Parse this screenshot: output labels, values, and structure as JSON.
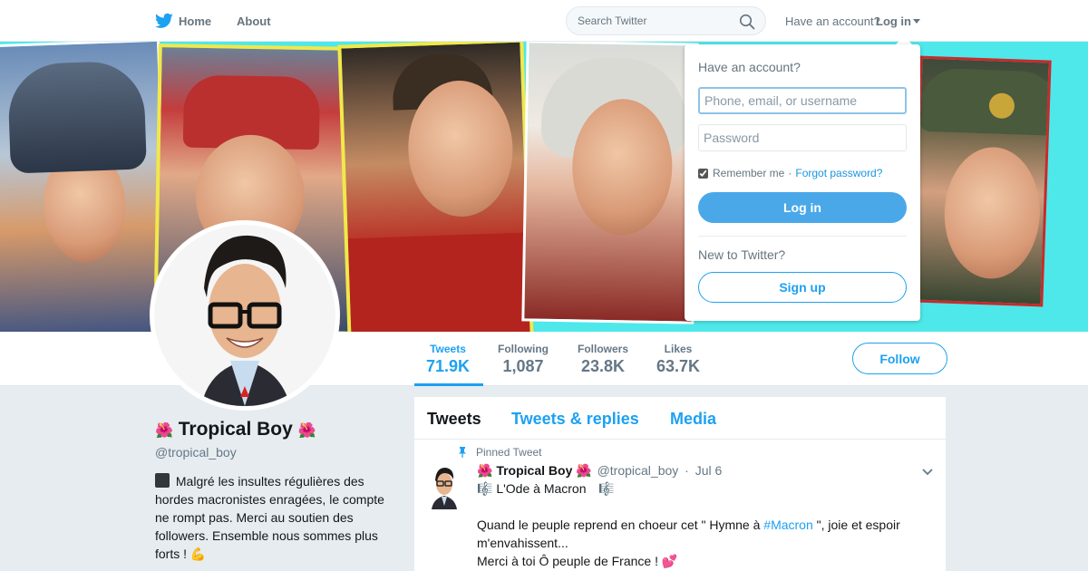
{
  "nav": {
    "home_label": "Home",
    "about_label": "About",
    "search_placeholder": "Search Twitter",
    "have_account": "Have an account?",
    "login_label": "Log in",
    "brand_color": "#1da1f2"
  },
  "profile": {
    "name": "Tropical Boy",
    "name_emoji_left": "🌺",
    "name_emoji_right": "🌺",
    "handle": "@tropical_boy",
    "bio": "Malgré les insultes régulières des hordes macronistes enragées, le compte ne rompt pas. Merci au soutien des followers. Ensemble nous sommes plus forts !",
    "bio_emoji": "💪"
  },
  "stats": [
    {
      "label": "Tweets",
      "value": "71.9K"
    },
    {
      "label": "Following",
      "value": "1,087"
    },
    {
      "label": "Followers",
      "value": "23.8K"
    },
    {
      "label": "Likes",
      "value": "63.7K"
    }
  ],
  "follow_label": "Follow",
  "tabs": [
    "Tweets",
    "Tweets & replies",
    "Media"
  ],
  "tweet": {
    "pinned_label": "Pinned Tweet",
    "author": "Tropical Boy",
    "handle": "@tropical_boy",
    "date": "Jul 6",
    "music_note": "🎼",
    "line1": "L'Ode à Macron",
    "line2_before": "Quand le peuple reprend en choeur cet \" Hymne à ",
    "hashtag": "#Macron",
    "line2_after": " \", joie et espoir m'envahissent...",
    "line3": "Merci à toi Ô peuple de France !",
    "heart": "💕"
  },
  "login_dropdown": {
    "title": "Have an account?",
    "username_placeholder": "Phone, email, or username",
    "password_placeholder": "Password",
    "remember_label": "Remember me",
    "separator": "·",
    "forgot_label": "Forgot password?",
    "login_button": "Log in",
    "new_label": "New to Twitter?",
    "signup_button": "Sign up"
  }
}
